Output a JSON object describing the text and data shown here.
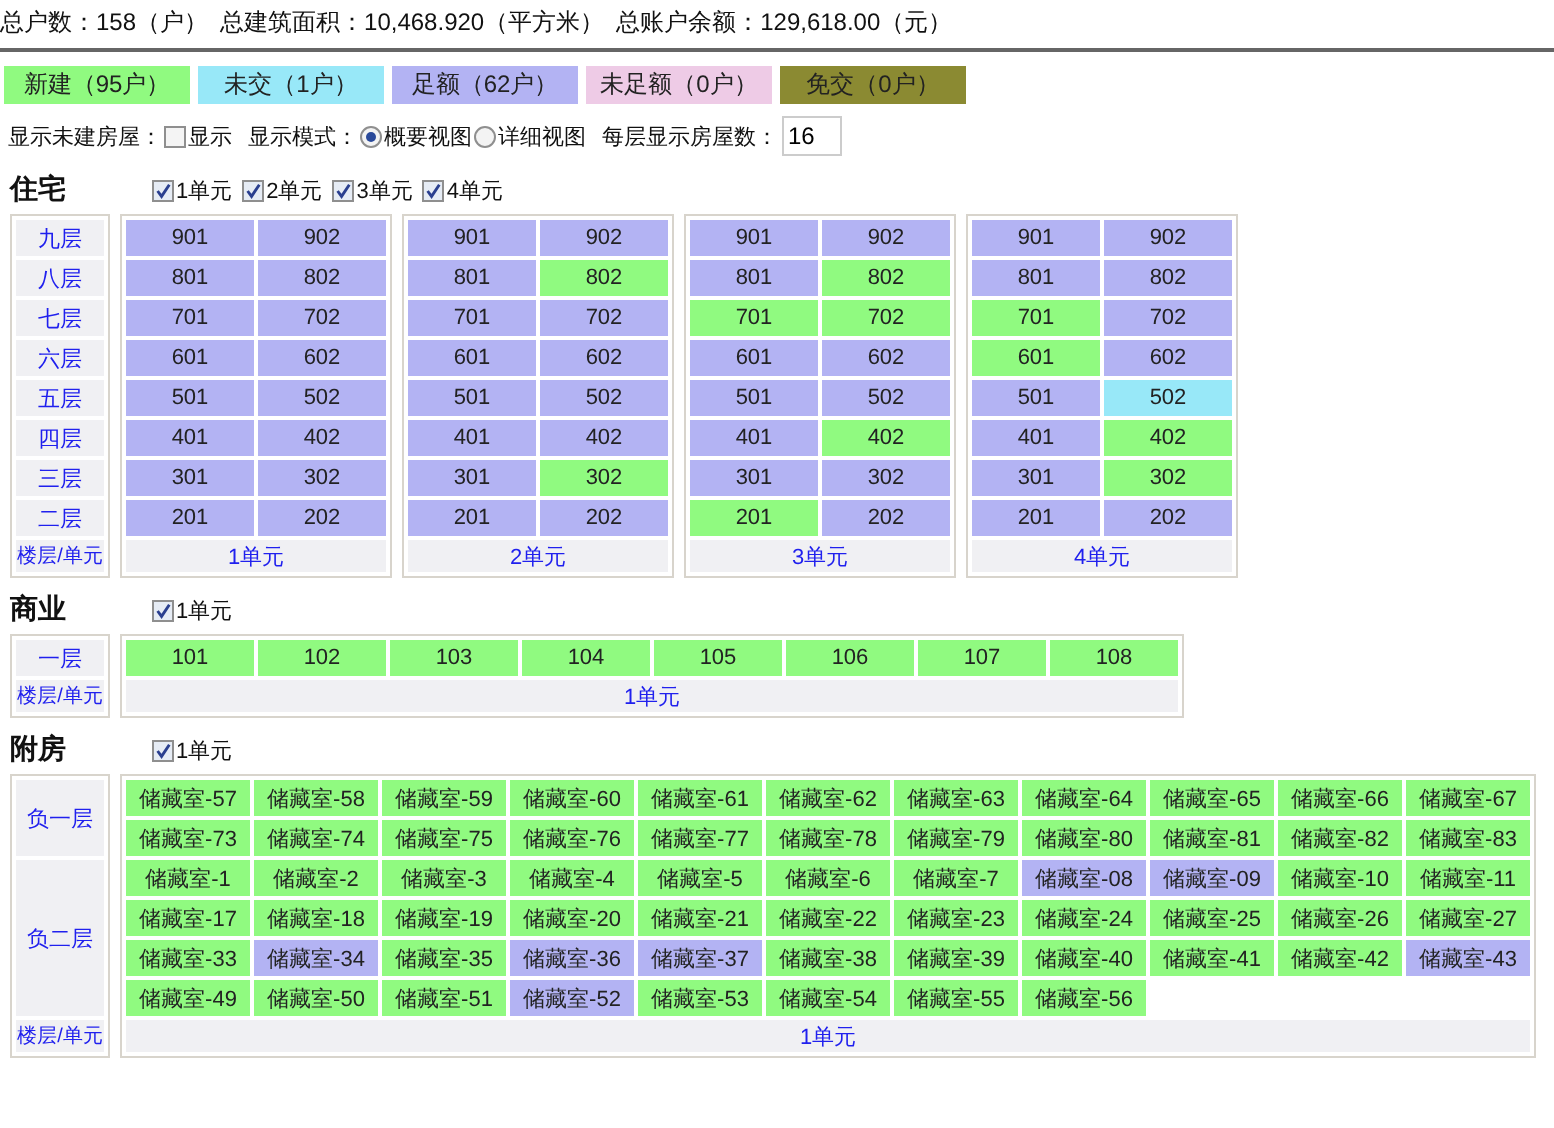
{
  "summary": [
    "总户数：158（户）",
    "总建筑面积：10,468.920（平方米）",
    "总账户余额：129,618.00（元）"
  ],
  "legend": [
    {
      "label": "新建（95户）",
      "color": "#90fa80"
    },
    {
      "label": "未交（1户）",
      "color": "#98e8f8"
    },
    {
      "label": "足额（62户）",
      "color": "#b3b3f3"
    },
    {
      "label": "未足额（0户）",
      "color": "#eecbe6"
    },
    {
      "label": "免交（0户）",
      "color": "#8b8a32"
    }
  ],
  "options": {
    "show_unbuilt": {
      "label": "显示未建房屋：",
      "checkbox_label": "显示",
      "checked": false
    },
    "display_mode": {
      "label": "显示模式：",
      "choices": [
        {
          "label": "概要视图",
          "selected": true
        },
        {
          "label": "详细视图",
          "selected": false
        }
      ]
    },
    "per_floor": {
      "label": "每层显示房屋数：",
      "value": "16"
    }
  },
  "sections": [
    {
      "kind": "residential",
      "title": "住宅",
      "corner": "楼层/单元",
      "unit_filters": [
        {
          "label": "1单元",
          "checked": true
        },
        {
          "label": "2单元",
          "checked": true
        },
        {
          "label": "3单元",
          "checked": true
        },
        {
          "label": "4单元",
          "checked": true
        }
      ],
      "floors": [
        "九层",
        "八层",
        "七层",
        "六层",
        "五层",
        "四层",
        "三层",
        "二层"
      ],
      "units": [
        {
          "name": "1单元",
          "floors": [
            [
              {
                "label": "901",
                "color": "#b3b3f3"
              },
              {
                "label": "902",
                "color": "#b3b3f3"
              }
            ],
            [
              {
                "label": "801",
                "color": "#b3b3f3"
              },
              {
                "label": "802",
                "color": "#b3b3f3"
              }
            ],
            [
              {
                "label": "701",
                "color": "#b3b3f3"
              },
              {
                "label": "702",
                "color": "#b3b3f3"
              }
            ],
            [
              {
                "label": "601",
                "color": "#b3b3f3"
              },
              {
                "label": "602",
                "color": "#b3b3f3"
              }
            ],
            [
              {
                "label": "501",
                "color": "#b3b3f3"
              },
              {
                "label": "502",
                "color": "#b3b3f3"
              }
            ],
            [
              {
                "label": "401",
                "color": "#b3b3f3"
              },
              {
                "label": "402",
                "color": "#b3b3f3"
              }
            ],
            [
              {
                "label": "301",
                "color": "#b3b3f3"
              },
              {
                "label": "302",
                "color": "#b3b3f3"
              }
            ],
            [
              {
                "label": "201",
                "color": "#b3b3f3"
              },
              {
                "label": "202",
                "color": "#b3b3f3"
              }
            ]
          ]
        },
        {
          "name": "2单元",
          "floors": [
            [
              {
                "label": "901",
                "color": "#b3b3f3"
              },
              {
                "label": "902",
                "color": "#b3b3f3"
              }
            ],
            [
              {
                "label": "801",
                "color": "#b3b3f3"
              },
              {
                "label": "802",
                "color": "#90fa80"
              }
            ],
            [
              {
                "label": "701",
                "color": "#b3b3f3"
              },
              {
                "label": "702",
                "color": "#b3b3f3"
              }
            ],
            [
              {
                "label": "601",
                "color": "#b3b3f3"
              },
              {
                "label": "602",
                "color": "#b3b3f3"
              }
            ],
            [
              {
                "label": "501",
                "color": "#b3b3f3"
              },
              {
                "label": "502",
                "color": "#b3b3f3"
              }
            ],
            [
              {
                "label": "401",
                "color": "#b3b3f3"
              },
              {
                "label": "402",
                "color": "#b3b3f3"
              }
            ],
            [
              {
                "label": "301",
                "color": "#b3b3f3"
              },
              {
                "label": "302",
                "color": "#90fa80"
              }
            ],
            [
              {
                "label": "201",
                "color": "#b3b3f3"
              },
              {
                "label": "202",
                "color": "#b3b3f3"
              }
            ]
          ]
        },
        {
          "name": "3单元",
          "floors": [
            [
              {
                "label": "901",
                "color": "#b3b3f3"
              },
              {
                "label": "902",
                "color": "#b3b3f3"
              }
            ],
            [
              {
                "label": "801",
                "color": "#b3b3f3"
              },
              {
                "label": "802",
                "color": "#90fa80"
              }
            ],
            [
              {
                "label": "701",
                "color": "#90fa80"
              },
              {
                "label": "702",
                "color": "#90fa80"
              }
            ],
            [
              {
                "label": "601",
                "color": "#b3b3f3"
              },
              {
                "label": "602",
                "color": "#b3b3f3"
              }
            ],
            [
              {
                "label": "501",
                "color": "#b3b3f3"
              },
              {
                "label": "502",
                "color": "#b3b3f3"
              }
            ],
            [
              {
                "label": "401",
                "color": "#b3b3f3"
              },
              {
                "label": "402",
                "color": "#90fa80"
              }
            ],
            [
              {
                "label": "301",
                "color": "#b3b3f3"
              },
              {
                "label": "302",
                "color": "#b3b3f3"
              }
            ],
            [
              {
                "label": "201",
                "color": "#90fa80"
              },
              {
                "label": "202",
                "color": "#b3b3f3"
              }
            ]
          ]
        },
        {
          "name": "4单元",
          "floors": [
            [
              {
                "label": "901",
                "color": "#b3b3f3"
              },
              {
                "label": "902",
                "color": "#b3b3f3"
              }
            ],
            [
              {
                "label": "801",
                "color": "#b3b3f3"
              },
              {
                "label": "802",
                "color": "#b3b3f3"
              }
            ],
            [
              {
                "label": "701",
                "color": "#90fa80"
              },
              {
                "label": "702",
                "color": "#b3b3f3"
              }
            ],
            [
              {
                "label": "601",
                "color": "#90fa80"
              },
              {
                "label": "602",
                "color": "#b3b3f3"
              }
            ],
            [
              {
                "label": "501",
                "color": "#b3b3f3"
              },
              {
                "label": "502",
                "color": "#98e8f8"
              }
            ],
            [
              {
                "label": "401",
                "color": "#b3b3f3"
              },
              {
                "label": "402",
                "color": "#90fa80"
              }
            ],
            [
              {
                "label": "301",
                "color": "#b3b3f3"
              },
              {
                "label": "302",
                "color": "#90fa80"
              }
            ],
            [
              {
                "label": "201",
                "color": "#b3b3f3"
              },
              {
                "label": "202",
                "color": "#b3b3f3"
              }
            ]
          ]
        }
      ]
    },
    {
      "kind": "commercial",
      "title": "商业",
      "corner": "楼层/单元",
      "unit_filters": [
        {
          "label": "1单元",
          "checked": true
        }
      ],
      "floors": [
        "一层"
      ],
      "units": [
        {
          "name": "1单元",
          "floors": [
            [
              {
                "label": "101",
                "color": "#90fa80"
              },
              {
                "label": "102",
                "color": "#90fa80"
              },
              {
                "label": "103",
                "color": "#90fa80"
              },
              {
                "label": "104",
                "color": "#90fa80"
              },
              {
                "label": "105",
                "color": "#90fa80"
              },
              {
                "label": "106",
                "color": "#90fa80"
              },
              {
                "label": "107",
                "color": "#90fa80"
              },
              {
                "label": "108",
                "color": "#90fa80"
              }
            ]
          ]
        }
      ]
    },
    {
      "kind": "annex",
      "title": "附房",
      "corner": "楼层/单元",
      "unit_filters": [
        {
          "label": "1单元",
          "checked": true
        }
      ],
      "floors": [
        "负一层",
        "负二层"
      ],
      "units": [
        {
          "name": "1单元",
          "floors": [
            [
              {
                "label": "储藏室-57",
                "color": "#90fa80"
              },
              {
                "label": "储藏室-58",
                "color": "#90fa80"
              },
              {
                "label": "储藏室-59",
                "color": "#90fa80"
              },
              {
                "label": "储藏室-60",
                "color": "#90fa80"
              },
              {
                "label": "储藏室-61",
                "color": "#90fa80"
              },
              {
                "label": "储藏室-62",
                "color": "#90fa80"
              },
              {
                "label": "储藏室-63",
                "color": "#90fa80"
              },
              {
                "label": "储藏室-64",
                "color": "#90fa80"
              },
              {
                "label": "储藏室-65",
                "color": "#90fa80"
              },
              {
                "label": "储藏室-66",
                "color": "#90fa80"
              },
              {
                "label": "储藏室-67",
                "color": "#90fa80"
              },
              {
                "label": "储藏室-73",
                "color": "#90fa80"
              },
              {
                "label": "储藏室-74",
                "color": "#90fa80"
              },
              {
                "label": "储藏室-75",
                "color": "#90fa80"
              },
              {
                "label": "储藏室-76",
                "color": "#90fa80"
              },
              {
                "label": "储藏室-77",
                "color": "#90fa80"
              },
              {
                "label": "储藏室-78",
                "color": "#90fa80"
              },
              {
                "label": "储藏室-79",
                "color": "#90fa80"
              },
              {
                "label": "储藏室-80",
                "color": "#90fa80"
              },
              {
                "label": "储藏室-81",
                "color": "#90fa80"
              },
              {
                "label": "储藏室-82",
                "color": "#90fa80"
              },
              {
                "label": "储藏室-83",
                "color": "#90fa80"
              }
            ],
            [
              {
                "label": "储藏室-1",
                "color": "#90fa80"
              },
              {
                "label": "储藏室-2",
                "color": "#90fa80"
              },
              {
                "label": "储藏室-3",
                "color": "#90fa80"
              },
              {
                "label": "储藏室-4",
                "color": "#90fa80"
              },
              {
                "label": "储藏室-5",
                "color": "#90fa80"
              },
              {
                "label": "储藏室-6",
                "color": "#90fa80"
              },
              {
                "label": "储藏室-7",
                "color": "#90fa80"
              },
              {
                "label": "储藏室-08",
                "color": "#b3b3f3"
              },
              {
                "label": "储藏室-09",
                "color": "#b3b3f3"
              },
              {
                "label": "储藏室-10",
                "color": "#90fa80"
              },
              {
                "label": "储藏室-11",
                "color": "#90fa80"
              },
              {
                "label": "储藏室-17",
                "color": "#90fa80"
              },
              {
                "label": "储藏室-18",
                "color": "#90fa80"
              },
              {
                "label": "储藏室-19",
                "color": "#90fa80"
              },
              {
                "label": "储藏室-20",
                "color": "#90fa80"
              },
              {
                "label": "储藏室-21",
                "color": "#90fa80"
              },
              {
                "label": "储藏室-22",
                "color": "#90fa80"
              },
              {
                "label": "储藏室-23",
                "color": "#90fa80"
              },
              {
                "label": "储藏室-24",
                "color": "#90fa80"
              },
              {
                "label": "储藏室-25",
                "color": "#90fa80"
              },
              {
                "label": "储藏室-26",
                "color": "#90fa80"
              },
              {
                "label": "储藏室-27",
                "color": "#90fa80"
              },
              {
                "label": "储藏室-33",
                "color": "#90fa80"
              },
              {
                "label": "储藏室-34",
                "color": "#b3b3f3"
              },
              {
                "label": "储藏室-35",
                "color": "#90fa80"
              },
              {
                "label": "储藏室-36",
                "color": "#b3b3f3"
              },
              {
                "label": "储藏室-37",
                "color": "#b3b3f3"
              },
              {
                "label": "储藏室-38",
                "color": "#90fa80"
              },
              {
                "label": "储藏室-39",
                "color": "#90fa80"
              },
              {
                "label": "储藏室-40",
                "color": "#90fa80"
              },
              {
                "label": "储藏室-41",
                "color": "#90fa80"
              },
              {
                "label": "储藏室-42",
                "color": "#90fa80"
              },
              {
                "label": "储藏室-43",
                "color": "#b3b3f3"
              },
              {
                "label": "储藏室-49",
                "color": "#90fa80"
              },
              {
                "label": "储藏室-50",
                "color": "#90fa80"
              },
              {
                "label": "储藏室-51",
                "color": "#90fa80"
              },
              {
                "label": "储藏室-52",
                "color": "#b3b3f3"
              },
              {
                "label": "储藏室-53",
                "color": "#90fa80"
              },
              {
                "label": "储藏室-54",
                "color": "#90fa80"
              },
              {
                "label": "储藏室-55",
                "color": "#90fa80"
              },
              {
                "label": "储藏室-56",
                "color": "#90fa80"
              }
            ]
          ]
        }
      ]
    }
  ]
}
